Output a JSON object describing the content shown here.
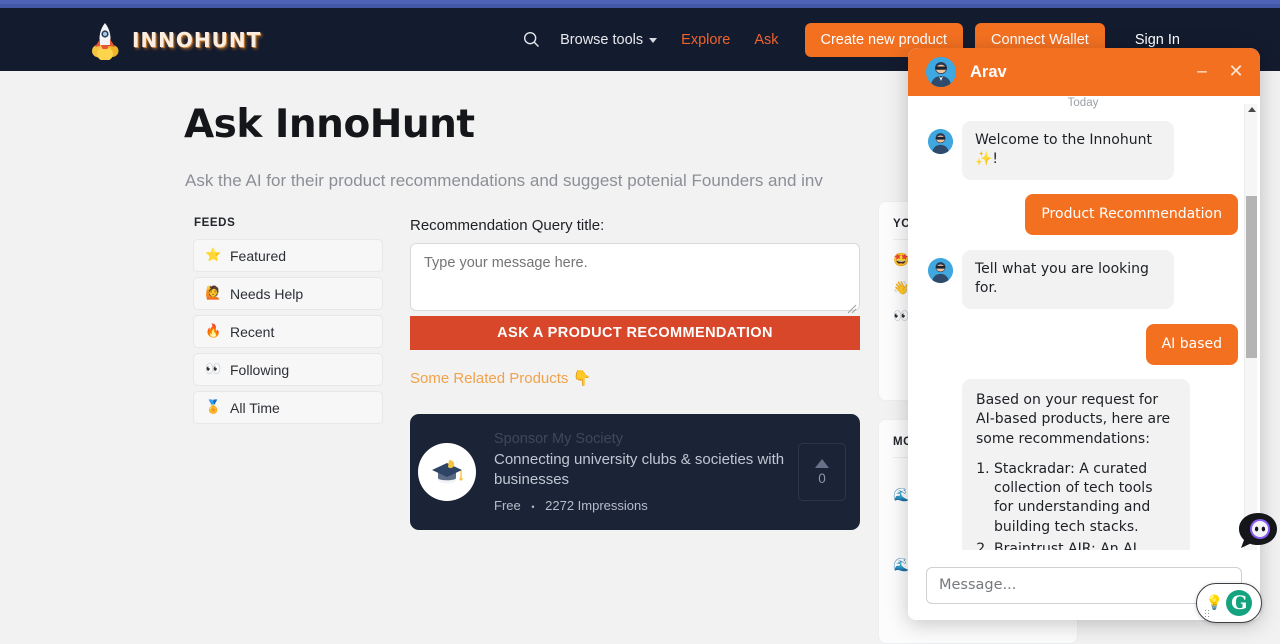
{
  "navbar": {
    "brand": "INNOHUNT",
    "logo_icon": "rocket-icon",
    "search_icon": "search-icon",
    "browse_tools": "Browse tools",
    "chevron_icon": "chevron-down-icon",
    "explore": "Explore",
    "ask": "Ask",
    "create_product": "Create new product",
    "connect_wallet": "Connect Wallet",
    "sign_in": "Sign In",
    "accent_color": "#f37021",
    "bg_color": "#131b2e"
  },
  "main": {
    "title": "Ask InnoHunt",
    "subtitle": "Ask the AI for their product recommendations and suggest potenial Founders and inv"
  },
  "feeds": {
    "heading": "FEEDS",
    "items": [
      {
        "label": "Featured",
        "emoji": "⭐",
        "icon": "star-icon"
      },
      {
        "label": "Needs Help",
        "emoji": "🙋",
        "icon": "raising-hand-icon"
      },
      {
        "label": "Recent",
        "emoji": "🔥",
        "icon": "fire-icon"
      },
      {
        "label": "Following",
        "emoji": "👀",
        "icon": "eyes-icon"
      },
      {
        "label": "All Time",
        "emoji": "🏅",
        "icon": "medal-icon"
      }
    ]
  },
  "query": {
    "label": "Recommendation Query title:",
    "placeholder": "Type your message here.",
    "value": "",
    "submit": "ASK A PRODUCT RECOMMENDATION",
    "related_link": "Some Related Products 👇",
    "submit_color": "#d9472b"
  },
  "sponsor": {
    "name": "Sponsor My Society",
    "description": "Connecting university clubs & societies with businesses",
    "price": "Free",
    "separator": "•",
    "impressions": "2272 Impressions",
    "vote_count": "0",
    "vote_icon": "upvote-triangle-icon",
    "avatar_icon": "graduation-cap-icon"
  },
  "right_panels": [
    {
      "title": "YO",
      "rows": [
        "🤩",
        "👋",
        "👀"
      ]
    },
    {
      "title": "MO",
      "rows": [
        "🌊",
        "🌊"
      ]
    }
  ],
  "chat": {
    "agent_name": "Arav",
    "avatar_icon": "agent-avatar-icon",
    "minimize_icon": "minimize-icon",
    "close_icon": "close-icon",
    "daystamp": "Today",
    "messages": [
      {
        "from": "agent",
        "text": "Welcome to the Innohunt ✨!",
        "type": "text"
      },
      {
        "from": "user",
        "text": "Product Recommendation",
        "type": "text"
      },
      {
        "from": "agent",
        "text": "Tell what you are looking for.",
        "type": "text"
      },
      {
        "from": "user",
        "text": "AI based",
        "type": "text"
      },
      {
        "from": "agent",
        "type": "list",
        "intro": "Based on your request for AI-based products, here are some recommendations:",
        "items": [
          "Stackradar: A curated collection of tech tools for understanding and building tech stacks.",
          "Braintrust AIR: An AI recruiter that assists with job matching and"
        ]
      }
    ],
    "input_placeholder": "Message...",
    "input_value": "",
    "header_color": "#f37021",
    "scroll_up_icon": "scroll-up-arrow-icon"
  },
  "grammarly": {
    "bulb_icon": "lightbulb-icon",
    "logo_letter": "G",
    "drag_icon": "drag-handle-icon"
  },
  "launcher": {
    "icon": "chat-launcher-icon"
  }
}
